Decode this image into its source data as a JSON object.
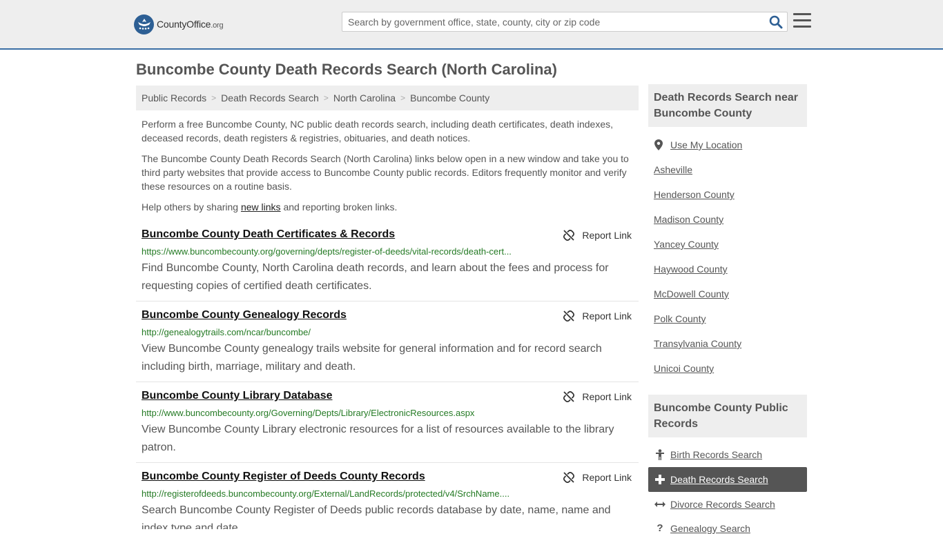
{
  "header": {
    "logo_text_main": "CountyOffice",
    "logo_text_tld": ".org",
    "search_placeholder": "Search by government office, state, county, city or zip code"
  },
  "page_title": "Buncombe County Death Records Search (North Carolina)",
  "breadcrumb": [
    "Public Records",
    "Death Records Search",
    "North Carolina",
    "Buncombe County"
  ],
  "intro": {
    "p1": "Perform a free Buncombe County, NC public death records search, including death certificates, death indexes, deceased records, death registers & registries, obituaries, and death notices.",
    "p2": "The Buncombe County Death Records Search (North Carolina) links below open in a new window and take you to third party websites that provide access to Buncombe County public records. Editors frequently monitor and verify these resources on a routine basis.",
    "p3_before": "Help others by sharing ",
    "p3_link": "new links",
    "p3_after": " and reporting broken links."
  },
  "report_label": "Report Link",
  "results": [
    {
      "title": "Buncombe County Death Certificates & Records",
      "url": "https://www.buncombecounty.org/governing/depts/register-of-deeds/vital-records/death-cert...",
      "desc": "Find Buncombe County, North Carolina death records, and learn about the fees and process for requesting copies of certified death certificates."
    },
    {
      "title": "Buncombe County Genealogy Records",
      "url": "http://genealogytrails.com/ncar/buncombe/",
      "desc": "View Buncombe County genealogy trails website for general information and for record search including birth, marriage, military and death."
    },
    {
      "title": "Buncombe County Library Database",
      "url": "http://www.buncombecounty.org/Governing/Depts/Library/ElectronicResources.aspx",
      "desc": "View Buncombe County Library electronic resources for a list of resources available to the library patron."
    },
    {
      "title": "Buncombe County Register of Deeds County Records",
      "url": "http://registerofdeeds.buncombecounty.org/External/LandRecords/protected/v4/SrchName....",
      "desc": "Search Buncombe County Register of Deeds public records database by date, name, name and index type and date."
    }
  ],
  "sidebar": {
    "nearby_heading": "Death Records Search near Buncombe County",
    "use_location": "Use My Location",
    "nearby": [
      "Asheville",
      "Henderson County",
      "Madison County",
      "Yancey County",
      "Haywood County",
      "McDowell County",
      "Polk County",
      "Transylvania County",
      "Unicoi County"
    ],
    "public_heading": "Buncombe County Public Records",
    "public_links": [
      {
        "icon": "person-icon",
        "label": "Birth Records Search"
      },
      {
        "icon": "cross-icon",
        "label": "Death Records Search"
      },
      {
        "icon": "arrows-icon",
        "label": "Divorce Records Search"
      },
      {
        "icon": "question-icon",
        "label": "Genealogy Search"
      }
    ]
  },
  "colors": {
    "accent": "#3a6ea5",
    "url_green": "#247a24",
    "active_bg": "#555555"
  }
}
